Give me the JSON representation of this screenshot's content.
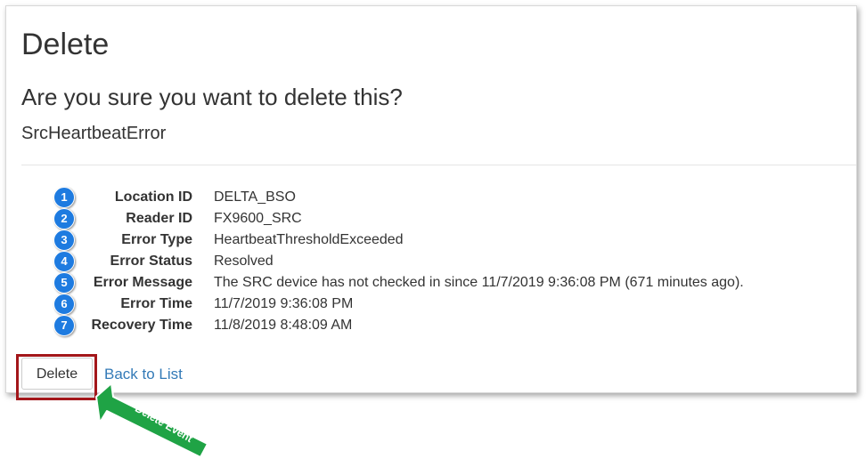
{
  "page": {
    "heading": "Delete",
    "confirm_question": "Are you sure you want to delete this?",
    "entity_name": "SrcHeartbeatError"
  },
  "details": [
    {
      "number": "1",
      "label": "Location ID",
      "value": "DELTA_BSO"
    },
    {
      "number": "2",
      "label": "Reader ID",
      "value": "FX9600_SRC"
    },
    {
      "number": "3",
      "label": "Error Type",
      "value": "HeartbeatThresholdExceeded"
    },
    {
      "number": "4",
      "label": "Error Status",
      "value": "Resolved"
    },
    {
      "number": "5",
      "label": "Error Message",
      "value": "The SRC device has not checked in since 11/7/2019 9:36:08 PM (671 minutes ago)."
    },
    {
      "number": "6",
      "label": "Error Time",
      "value": "11/7/2019 9:36:08 PM"
    },
    {
      "number": "7",
      "label": "Recovery Time",
      "value": "11/8/2019 8:48:09 AM"
    }
  ],
  "actions": {
    "delete_label": "Delete",
    "back_label": "Back to List"
  },
  "annotation": {
    "arrow_label": "Delete Event",
    "arrow_color": "#1fa345",
    "highlight_color": "#a3161a",
    "badge_color": "#1e7be0",
    "link_color": "#337ab7"
  }
}
